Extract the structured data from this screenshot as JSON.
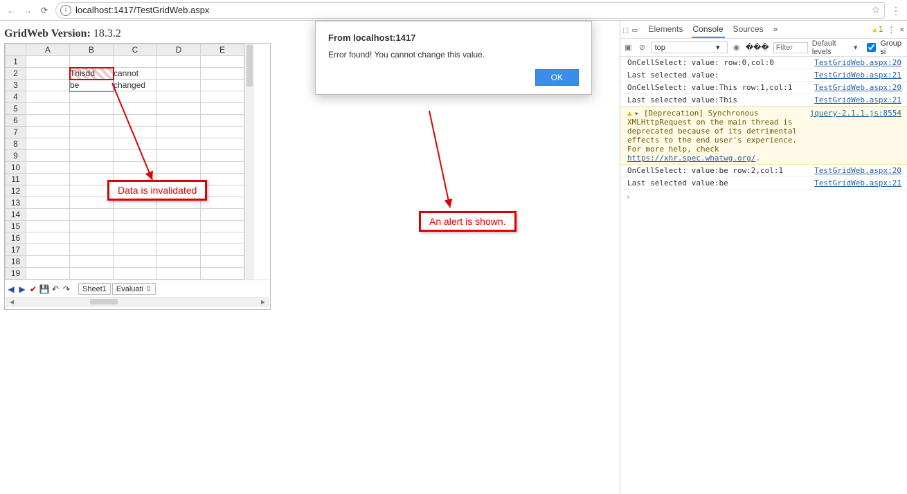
{
  "browser": {
    "url": "localhost:1417/TestGridWeb.aspx"
  },
  "gridweb": {
    "title_label": "GridWeb Version:",
    "version": "18.3.2",
    "columns": [
      "A",
      "B",
      "C",
      "D",
      "E"
    ],
    "row_count": 19,
    "cells": {
      "r2cB": "Thisdd",
      "r2cC": "cannot",
      "r3cB": "be",
      "r3cC": "changed"
    },
    "sheet_tabs": [
      "Sheet1",
      "Evaluati"
    ]
  },
  "callouts": {
    "data_invalid": "Data is invalidated",
    "alert_shown": "An alert is shown."
  },
  "alert": {
    "title": "From localhost:1417",
    "message": "Error found! You cannot change this value.",
    "ok": "OK"
  },
  "devtools": {
    "tabs": [
      "Elements",
      "Console",
      "Sources"
    ],
    "active_tab": "Console",
    "more": "»",
    "warn_count": "1",
    "subbar": {
      "context": "top",
      "filter_placeholder": "Filter",
      "levels": "Default levels",
      "group": "Group si"
    },
    "lines": [
      {
        "type": "log",
        "msg": "OnCellSelect: value: row:0,col:0",
        "src": "TestGridWeb.aspx:20"
      },
      {
        "type": "log",
        "msg": "Last selected value:",
        "src": "TestGridWeb.aspx:21"
      },
      {
        "type": "log",
        "msg": "OnCellSelect: value:This row:1,col:1",
        "src": "TestGridWeb.aspx:20"
      },
      {
        "type": "log",
        "msg": "Last selected value:This",
        "src": "TestGridWeb.aspx:21"
      },
      {
        "type": "warn",
        "msg": "[Deprecation] Synchronous XMLHttpRequest on the main thread is deprecated because of its detrimental effects to the end user's experience. For more help, check ",
        "link": "https://xhr.spec.whatwg.org/",
        "src": "jquery-2.1.1.js:8554"
      },
      {
        "type": "log",
        "msg": "OnCellSelect: value:be row:2,col:1",
        "src": "TestGridWeb.aspx:20"
      },
      {
        "type": "log",
        "msg": "Last selected value:be",
        "src": "TestGridWeb.aspx:21"
      }
    ]
  }
}
